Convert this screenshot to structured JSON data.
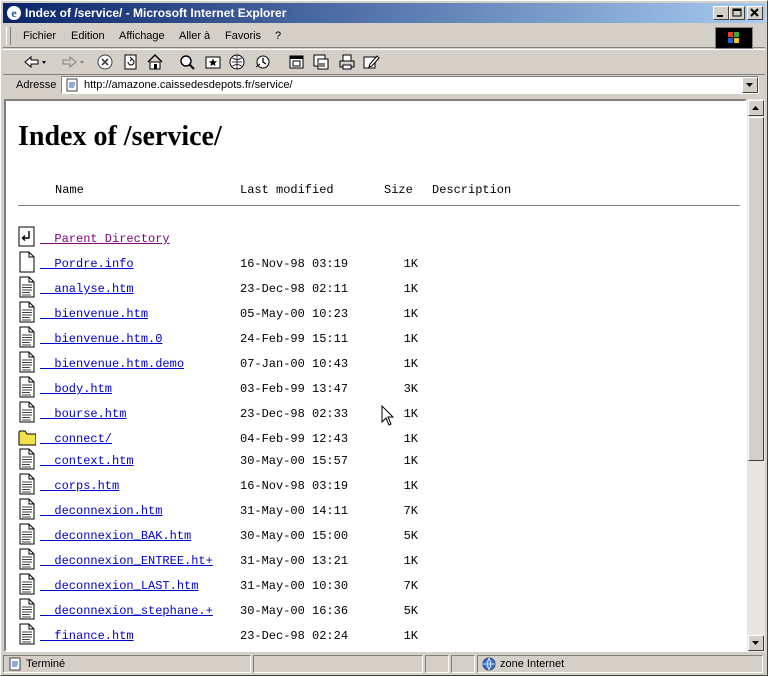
{
  "window": {
    "title": "Index of /service/ - Microsoft Internet Explorer"
  },
  "menu": [
    {
      "label": "Fichier"
    },
    {
      "label": "Edition"
    },
    {
      "label": "Affichage"
    },
    {
      "label": "Aller à"
    },
    {
      "label": "Favoris"
    },
    {
      "label": "?"
    }
  ],
  "address": {
    "label": "Adresse",
    "url": "http://amazone.caissedesdepots.fr/service/"
  },
  "page": {
    "heading": "Index of /service/",
    "columns": {
      "name": "Name",
      "modified": "Last modified",
      "size": "Size",
      "description": "Description"
    },
    "entries": [
      {
        "name": "Parent Directory",
        "date": "",
        "size": "",
        "icon": "back-icon"
      },
      {
        "name": "Pordre.info",
        "date": "16-Nov-98 03:19",
        "size": "1K",
        "icon": "file-icon"
      },
      {
        "name": "analyse.htm",
        "date": "23-Dec-98 02:11",
        "size": "1K",
        "icon": "text-file-icon"
      },
      {
        "name": "bienvenue.htm",
        "date": "05-May-00 10:23",
        "size": "1K",
        "icon": "text-file-icon"
      },
      {
        "name": "bienvenue.htm.0",
        "date": "24-Feb-99 15:11",
        "size": "1K",
        "icon": "text-file-icon"
      },
      {
        "name": "bienvenue.htm.demo",
        "date": "07-Jan-00 10:43",
        "size": "1K",
        "icon": "text-file-icon"
      },
      {
        "name": "body.htm",
        "date": "03-Feb-99 13:47",
        "size": "3K",
        "icon": "text-file-icon"
      },
      {
        "name": "bourse.htm",
        "date": "23-Dec-98 02:33",
        "size": "1K",
        "icon": "text-file-icon"
      },
      {
        "name": "connect/",
        "date": "04-Feb-99 12:43",
        "size": "1K",
        "icon": "folder-icon"
      },
      {
        "name": "context.htm",
        "date": "30-May-00 15:57",
        "size": "1K",
        "icon": "text-file-icon"
      },
      {
        "name": "corps.htm",
        "date": "16-Nov-98 03:19",
        "size": "1K",
        "icon": "text-file-icon"
      },
      {
        "name": "deconnexion.htm",
        "date": "31-May-00 14:11",
        "size": "7K",
        "icon": "text-file-icon"
      },
      {
        "name": "deconnexion_BAK.htm",
        "date": "30-May-00 15:00",
        "size": "5K",
        "icon": "text-file-icon"
      },
      {
        "name": "deconnexion_ENTREE.ht+",
        "date": "31-May-00 13:21",
        "size": "1K",
        "icon": "text-file-icon"
      },
      {
        "name": "deconnexion_LAST.htm",
        "date": "31-May-00 10:30",
        "size": "7K",
        "icon": "text-file-icon"
      },
      {
        "name": "deconnexion_stephane.+",
        "date": "30-May-00 16:36",
        "size": "5K",
        "icon": "text-file-icon"
      },
      {
        "name": "finance.htm",
        "date": "23-Dec-98 02:24",
        "size": "1K",
        "icon": "text-file-icon"
      }
    ]
  },
  "status": {
    "text": "Terminé",
    "zone": "zone Internet"
  }
}
